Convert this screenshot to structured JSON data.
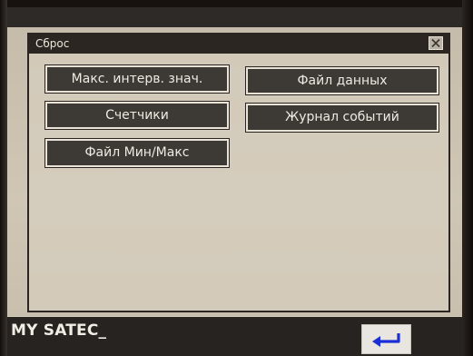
{
  "top_bar": {
    "text": ""
  },
  "dialog": {
    "title": "Сброс",
    "close_icon": "close-x-icon"
  },
  "buttons": {
    "max_interval": "Макс. интерв. знач.",
    "data_file": "Файл данных",
    "counters": "Счетчики",
    "event_log": "Журнал событий",
    "min_max_file": "Файл Мин/Макс"
  },
  "footer": {
    "brand": "MY SATEC_",
    "back_icon": "return-arrow-icon"
  },
  "colors": {
    "screen_bg": "#cfc6b6",
    "dialog_title_bg": "#2b2622",
    "button_bg": "#3d3935",
    "button_text": "#efeae2",
    "bottom_bar": "#262320",
    "back_arrow": "#1b2fd6"
  }
}
